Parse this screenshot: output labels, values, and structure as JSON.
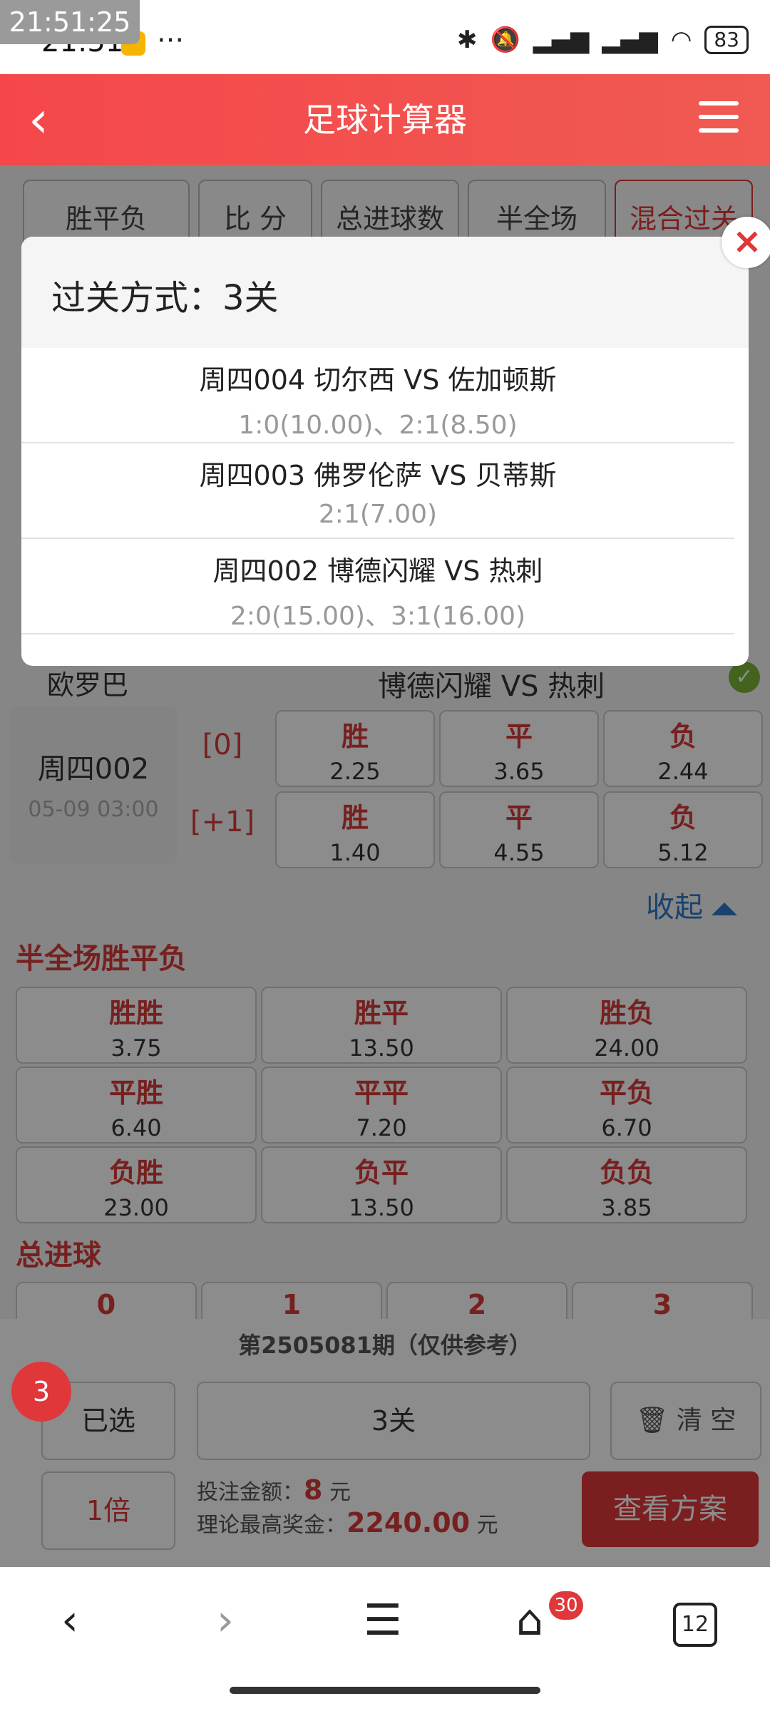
{
  "status": {
    "time_badge": "21:51:25",
    "time": "21:51",
    "dots": "···",
    "battery": "83"
  },
  "header": {
    "title": "足球计算器"
  },
  "tabs": [
    "胜平负",
    "比 分",
    "总进球数",
    "半全场",
    "混合过关"
  ],
  "match": {
    "league": "欧罗巴",
    "name": "博德闪耀  VS  热刺",
    "no": "周四002",
    "datetime": "05-09 03:00",
    "rows": [
      {
        "handicap": "[0]",
        "cells": [
          {
            "n": "胜",
            "v": "2.25"
          },
          {
            "n": "平",
            "v": "3.65"
          },
          {
            "n": "负",
            "v": "2.44"
          }
        ]
      },
      {
        "handicap": "[+1]",
        "cells": [
          {
            "n": "胜",
            "v": "1.40"
          },
          {
            "n": "平",
            "v": "4.55"
          },
          {
            "n": "负",
            "v": "5.12"
          }
        ]
      }
    ],
    "collapse": "收起"
  },
  "half_full": {
    "title": "半全场胜平负",
    "cells": [
      {
        "n": "胜胜",
        "v": "3.75"
      },
      {
        "n": "胜平",
        "v": "13.50"
      },
      {
        "n": "胜负",
        "v": "24.00"
      },
      {
        "n": "平胜",
        "v": "6.40"
      },
      {
        "n": "平平",
        "v": "7.20"
      },
      {
        "n": "平负",
        "v": "6.70"
      },
      {
        "n": "负胜",
        "v": "23.00"
      },
      {
        "n": "负平",
        "v": "13.50"
      },
      {
        "n": "负负",
        "v": "3.85"
      }
    ]
  },
  "total_goals": {
    "title": "总进球",
    "cells": [
      "0",
      "1",
      "2",
      "3"
    ]
  },
  "bottom": {
    "period": "第2505081期（仅供参考）",
    "count": "3",
    "selected": "已选",
    "pass": "3关",
    "clear": "清 空",
    "multiple": "1倍",
    "bet_label": "投注金额：",
    "bet_value": "8",
    "bet_unit": "元",
    "prize_label": "理论最高奖金：",
    "prize_value": "2240.00",
    "prize_unit": "元",
    "view": "查看方案"
  },
  "modal": {
    "title": "过关方式：3关",
    "rows": [
      {
        "match": "周四004   切尔西 VS 佐加顿斯",
        "odds": "1:0(10.00)、2:1(8.50)"
      },
      {
        "match": "周四003   佛罗伦萨 VS 贝蒂斯",
        "odds": "2:1(7.00)"
      },
      {
        "match": "周四002   博德闪耀 VS 热刺",
        "odds": "2:0(15.00)、3:1(16.00)"
      }
    ],
    "close": "×"
  },
  "navbar": {
    "home_badge": "30",
    "tabs_count": "12"
  }
}
